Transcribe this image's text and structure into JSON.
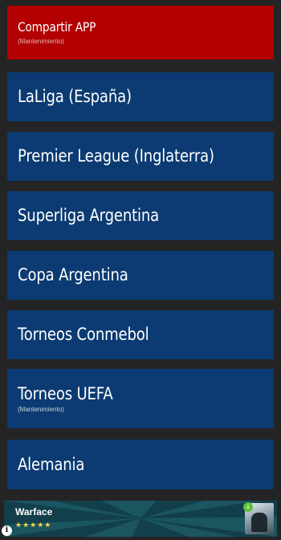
{
  "menu": {
    "items": [
      {
        "label": "Compartir APP",
        "sub": "(Mantenimiento)",
        "color": "#b30000"
      },
      {
        "label": "LaLiga (España)",
        "sub": "",
        "color": "#0b3b72"
      },
      {
        "label": "Premier League (Inglaterra)",
        "sub": "",
        "color": "#0b3b72"
      },
      {
        "label": "Superliga Argentina",
        "sub": "",
        "color": "#0b3b72"
      },
      {
        "label": "Copa Argentina",
        "sub": "",
        "color": "#0b3b72"
      },
      {
        "label": "Torneos Conmebol",
        "sub": "",
        "color": "#0b3b72"
      },
      {
        "label": "Torneos UEFA",
        "sub": "(Mantenimiento)",
        "color": "#0b3b72"
      },
      {
        "label": "Alemania",
        "sub": "",
        "color": "#0b3b72"
      }
    ]
  },
  "ad": {
    "title": "Warface",
    "rating": 4.5,
    "stars_text": "★★★★★",
    "badge_icon": "download-icon",
    "info_icon": "info-icon"
  }
}
